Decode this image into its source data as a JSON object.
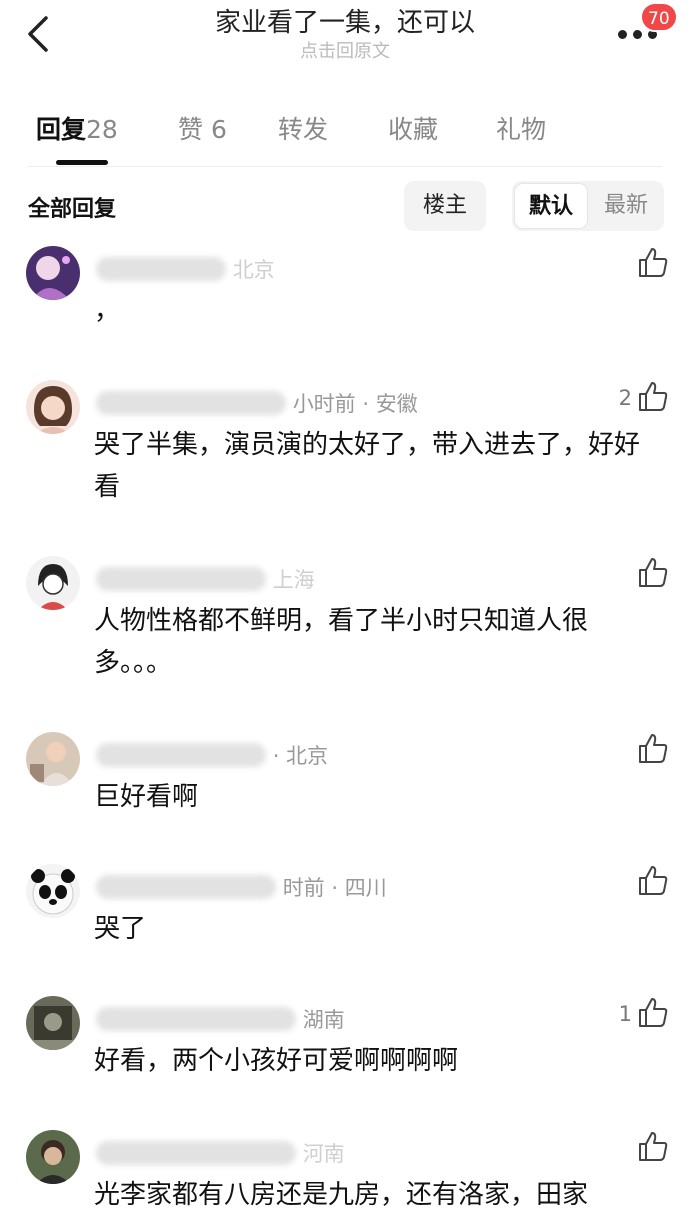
{
  "header": {
    "title": "家业看了一集，还可以",
    "subtitle": "点击回原文",
    "badge": "70"
  },
  "tabs": [
    {
      "label": "回复",
      "count": "28",
      "active": true
    },
    {
      "label": "赞",
      "count": "6",
      "active": false
    },
    {
      "label": "转发",
      "count": "",
      "active": false
    },
    {
      "label": "收藏",
      "count": "",
      "active": false
    },
    {
      "label": "礼物",
      "count": "",
      "active": false
    }
  ],
  "filter": {
    "label": "全部回复",
    "op_button": "楼主",
    "sort_selected": "默认",
    "sort_other": "最新"
  },
  "comments": [
    {
      "meta": "北京",
      "body": "，",
      "likes": ""
    },
    {
      "meta": "小时前 · 安徽",
      "body": "哭了半集，演员演的太好了，带入进去了，好好看",
      "likes": "2"
    },
    {
      "meta": "上海",
      "body": "人物性格都不鲜明，看了半小时只知道人很多。。。",
      "likes": ""
    },
    {
      "meta": "· 北京",
      "body": "巨好看啊",
      "likes": ""
    },
    {
      "meta": "时前 · 四川",
      "body": "哭了",
      "likes": ""
    },
    {
      "meta": "湖南",
      "body": "好看，两个小孩好可爱啊啊啊啊",
      "likes": "1"
    },
    {
      "meta": "河南",
      "body": "光李家都有八房还是九房，还有洛家，田家",
      "likes": ""
    }
  ],
  "colors": {
    "badge": "#f04848",
    "accent": "#111111",
    "muted": "#888888"
  },
  "icons": {
    "back": "chevron-left-icon",
    "more": "more-dots-icon",
    "like": "thumbs-up-icon"
  }
}
